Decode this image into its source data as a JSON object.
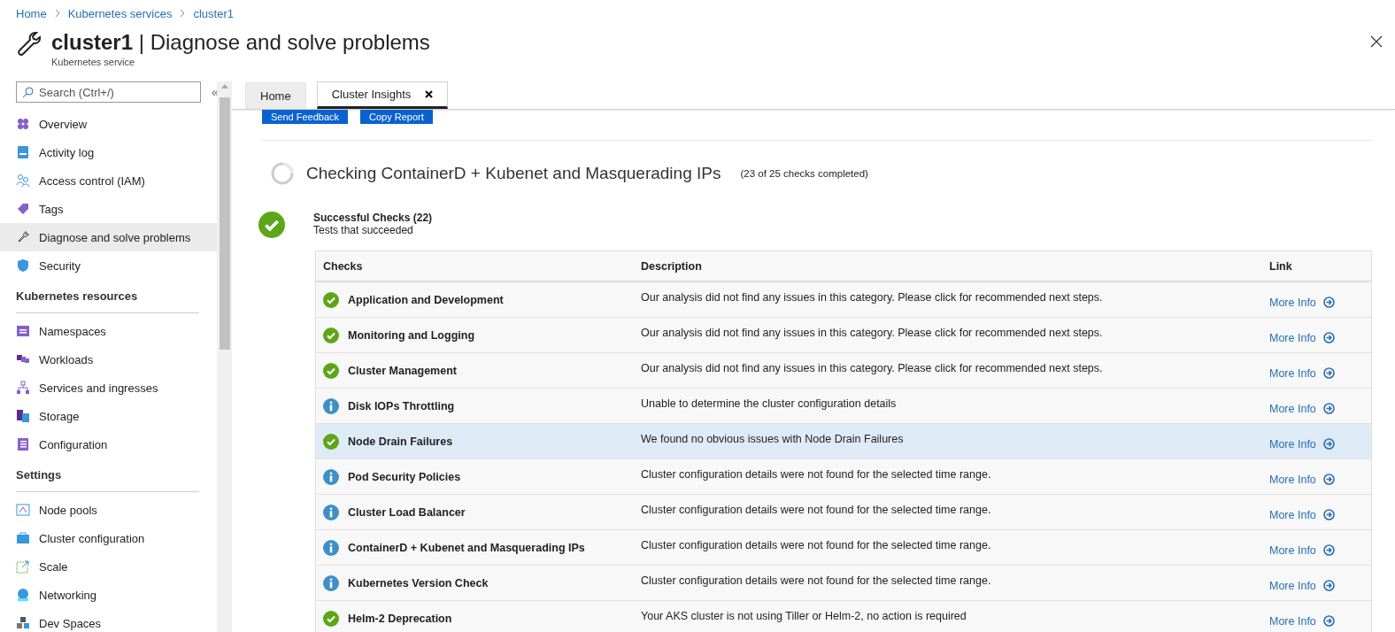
{
  "breadcrumb": [
    "Home",
    "Kubernetes services",
    "cluster1"
  ],
  "header": {
    "resource": "cluster1",
    "separator": "|",
    "page": "Diagnose and solve problems",
    "subtitle": "Kubernetes service"
  },
  "sidebar": {
    "search": {
      "placeholder": "Search (Ctrl+/)"
    },
    "collapse": "«",
    "items": [
      {
        "kind": "item",
        "label": "Overview",
        "selected": false
      },
      {
        "kind": "item",
        "label": "Activity log",
        "selected": false
      },
      {
        "kind": "item",
        "label": "Access control (IAM)",
        "selected": false
      },
      {
        "kind": "item",
        "label": "Tags",
        "selected": false
      },
      {
        "kind": "item",
        "label": "Diagnose and solve problems",
        "selected": true
      },
      {
        "kind": "item",
        "label": "Security",
        "selected": false
      },
      {
        "kind": "header",
        "label": "Kubernetes resources"
      },
      {
        "kind": "item",
        "label": "Namespaces",
        "selected": false
      },
      {
        "kind": "item",
        "label": "Workloads",
        "selected": false
      },
      {
        "kind": "item",
        "label": "Services and ingresses",
        "selected": false
      },
      {
        "kind": "item",
        "label": "Storage",
        "selected": false
      },
      {
        "kind": "item",
        "label": "Configuration",
        "selected": false
      },
      {
        "kind": "header",
        "label": "Settings"
      },
      {
        "kind": "item",
        "label": "Node pools",
        "selected": false
      },
      {
        "kind": "item",
        "label": "Cluster configuration",
        "selected": false
      },
      {
        "kind": "item",
        "label": "Scale",
        "selected": false
      },
      {
        "kind": "item",
        "label": "Networking",
        "selected": false
      },
      {
        "kind": "item",
        "label": "Dev Spaces",
        "selected": false
      }
    ]
  },
  "tabs": [
    {
      "label": "Home",
      "selected": false,
      "closable": false
    },
    {
      "label": "Cluster Insights",
      "selected": true,
      "closable": true
    }
  ],
  "actions": [
    "Send Feedback",
    "Copy Report"
  ],
  "progress": {
    "title": "Checking ContainerD + Kubenet and Masquerading IPs",
    "count": "(23 of 25 checks completed)"
  },
  "group": {
    "title": "Successful Checks (22)",
    "subtitle": "Tests that succeeded"
  },
  "table": {
    "columns": [
      "Checks",
      "Description",
      "Link"
    ],
    "rows": [
      {
        "kind": "success",
        "check": "Application and Development",
        "description": "Our analysis did not find any issues in this category. Please click for recommended next steps.",
        "link": "More Info",
        "selected": false
      },
      {
        "kind": "success",
        "check": "Monitoring and Logging",
        "description": "Our analysis did not find any issues in this category. Please click for recommended next steps.",
        "link": "More Info",
        "selected": false
      },
      {
        "kind": "success",
        "check": "Cluster Management",
        "description": "Our analysis did not find any issues in this category. Please click for recommended next steps.",
        "link": "More Info",
        "selected": false
      },
      {
        "kind": "info",
        "check": "Disk IOPs Throttling",
        "description": "Unable to determine the cluster configuration details",
        "link": "More Info",
        "selected": false
      },
      {
        "kind": "success",
        "check": "Node Drain Failures",
        "description": "We found no obvious issues with Node Drain Failures",
        "link": "More Info",
        "selected": true
      },
      {
        "kind": "info",
        "check": "Pod Security Policies",
        "description": "Cluster configuration details were not found for the selected time range.",
        "link": "More Info",
        "selected": false
      },
      {
        "kind": "info",
        "check": "Cluster Load Balancer",
        "description": "Cluster configuration details were not found for the selected time range.",
        "link": "More Info",
        "selected": false
      },
      {
        "kind": "info",
        "check": "ContainerD + Kubenet and Masquerading IPs",
        "description": "Cluster configuration details were not found for the selected time range.",
        "link": "More Info",
        "selected": false
      },
      {
        "kind": "info",
        "check": "Kubernetes Version Check",
        "description": "Cluster configuration details were not found for the selected time range.",
        "link": "More Info",
        "selected": false
      },
      {
        "kind": "success",
        "check": "Helm-2 Deprecation",
        "description": "Your AKS cluster is not using Tiller or Helm-2, no action is required",
        "link": "More Info",
        "selected": false
      }
    ]
  }
}
